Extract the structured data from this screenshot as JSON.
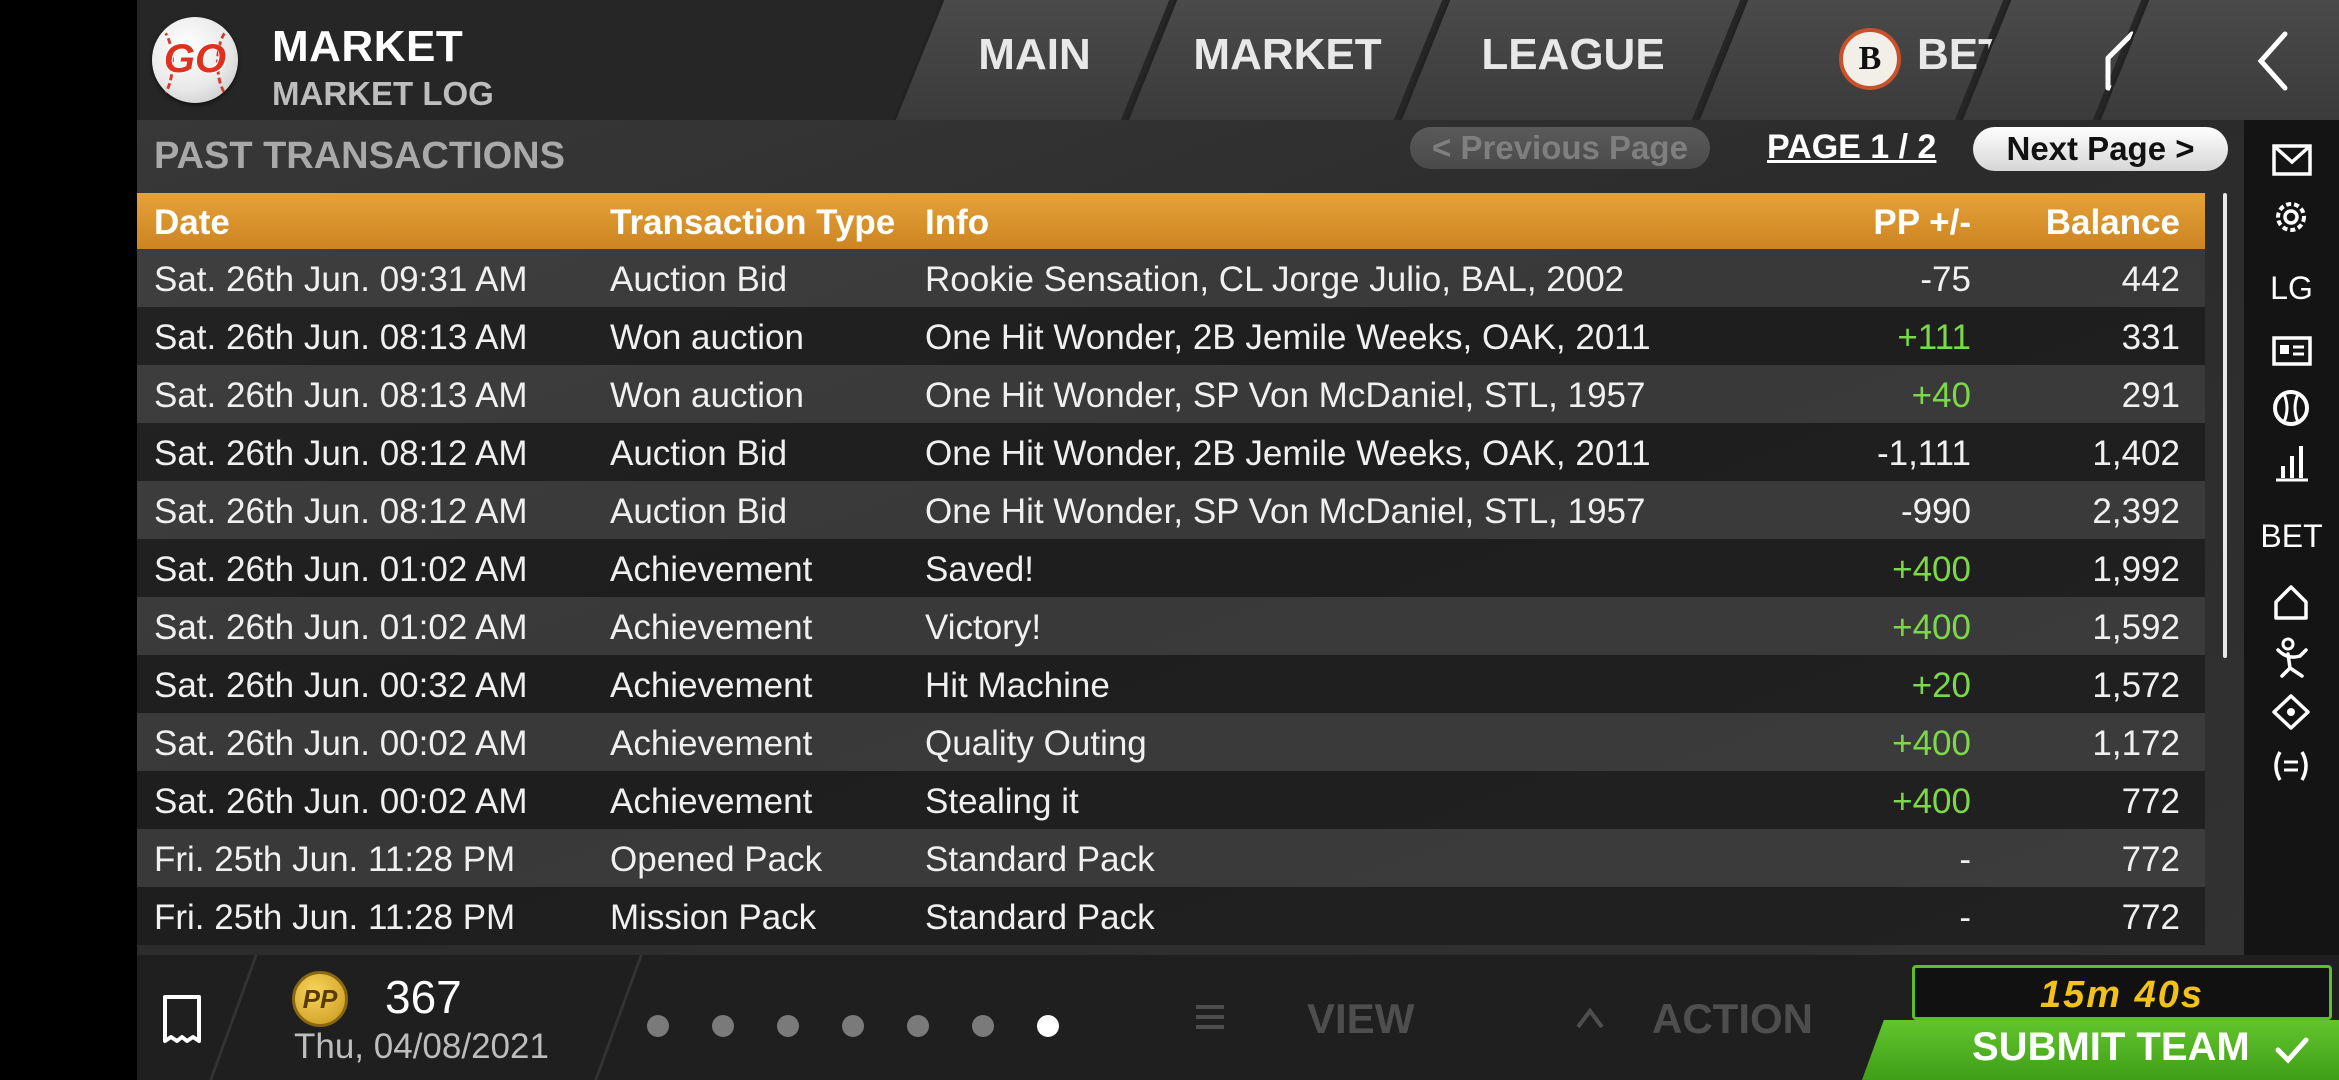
{
  "header": {
    "logo_text": "GO",
    "title": "MARKET",
    "subtitle": "MARKET LOG",
    "tabs": {
      "main": "MAIN",
      "market": "MARKET",
      "league": "LEAGUE",
      "bet_coin": "B",
      "bet": "BET"
    },
    "icons": [
      "home-icon",
      "back-chevron-icon"
    ]
  },
  "section": {
    "title": "PAST TRANSACTIONS",
    "prev_page": "< Previous Page",
    "page_indicator": "PAGE 1 / 2",
    "next_page": "Next Page >"
  },
  "table": {
    "headers": {
      "date": "Date",
      "type": "Transaction Type",
      "info": "Info",
      "pp": "PP +/-",
      "balance": "Balance"
    },
    "rows": [
      {
        "date": "Sat. 26th Jun. 09:31 AM",
        "type": "Auction Bid",
        "info": "Rookie Sensation, CL Jorge Julio, BAL, 2002",
        "pp": "-75",
        "balance": "442"
      },
      {
        "date": "Sat. 26th Jun. 08:13 AM",
        "type": "Won auction",
        "info": "One Hit Wonder, 2B Jemile Weeks, OAK, 2011",
        "pp": "+111",
        "balance": "331"
      },
      {
        "date": "Sat. 26th Jun. 08:13 AM",
        "type": "Won auction",
        "info": "One Hit Wonder, SP Von McDaniel, STL, 1957",
        "pp": "+40",
        "balance": "291"
      },
      {
        "date": "Sat. 26th Jun. 08:12 AM",
        "type": "Auction Bid",
        "info": "One Hit Wonder, 2B Jemile Weeks, OAK, 2011",
        "pp": "-1,111",
        "balance": "1,402"
      },
      {
        "date": "Sat. 26th Jun. 08:12 AM",
        "type": "Auction Bid",
        "info": "One Hit Wonder, SP Von McDaniel, STL, 1957",
        "pp": "-990",
        "balance": "2,392"
      },
      {
        "date": "Sat. 26th Jun. 01:02 AM",
        "type": "Achievement",
        "info": "Saved!",
        "pp": "+400",
        "balance": "1,992"
      },
      {
        "date": "Sat. 26th Jun. 01:02 AM",
        "type": "Achievement",
        "info": "Victory!",
        "pp": "+400",
        "balance": "1,592"
      },
      {
        "date": "Sat. 26th Jun. 00:32 AM",
        "type": "Achievement",
        "info": "Hit Machine",
        "pp": "+20",
        "balance": "1,572"
      },
      {
        "date": "Sat. 26th Jun. 00:02 AM",
        "type": "Achievement",
        "info": "Quality Outing",
        "pp": "+400",
        "balance": "1,172"
      },
      {
        "date": "Sat. 26th Jun. 00:02 AM",
        "type": "Achievement",
        "info": "Stealing it",
        "pp": "+400",
        "balance": "772"
      },
      {
        "date": "Fri. 25th Jun. 11:28 PM",
        "type": "Opened Pack",
        "info": "Standard Pack",
        "pp": "-",
        "balance": "772"
      },
      {
        "date": "Fri. 25th Jun. 11:28 PM",
        "type": "Mission Pack",
        "info": "Standard Pack",
        "pp": "-",
        "balance": "772"
      }
    ]
  },
  "sidebar": {
    "items": [
      {
        "name": "mail-icon"
      },
      {
        "name": "settings-gear-icon"
      },
      {
        "name": "league-label",
        "text": "LG"
      },
      {
        "name": "id-card-icon"
      },
      {
        "name": "baseball-icon"
      },
      {
        "name": "bar-chart-icon"
      },
      {
        "name": "bet-label",
        "text": "BET"
      },
      {
        "name": "home-icon"
      },
      {
        "name": "pitcher-icon"
      },
      {
        "name": "diamond-field-icon"
      },
      {
        "name": "trade-icon"
      }
    ]
  },
  "footer": {
    "pp_coin": "PP",
    "pp_value": "367",
    "date": "Thu, 04/08/2021",
    "page_dots": 7,
    "active_dot": 6,
    "view": "VIEW",
    "action": "ACTION",
    "timer": "15m 40s",
    "submit": "SUBMIT TEAM"
  },
  "colors": {
    "header_accent": "#e09a30",
    "positive": "#7cd848",
    "submit_green": "#4fb023",
    "timer_yellow": "#f2c21a"
  }
}
